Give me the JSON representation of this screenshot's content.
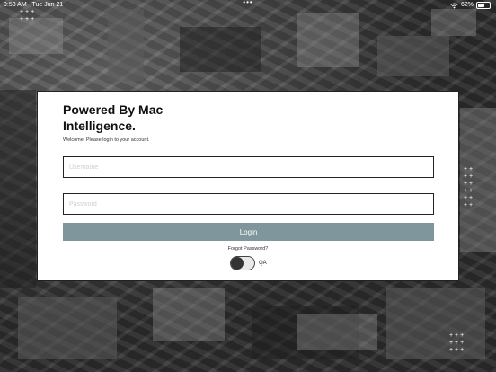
{
  "status_bar": {
    "time": "9:53 AM",
    "date": "Tue Jun 21",
    "multitask": "•••",
    "battery": "62%",
    "battery_level": 0.62
  },
  "card": {
    "title": "Powered By Mac Intelligence.",
    "welcome": "Welcome. Please login to your account.",
    "username_placeholder": "Username",
    "password_placeholder": "Password",
    "login_label": "Login",
    "forgot_label": "Forgot Password?",
    "qa_label": "QA",
    "qa_enabled": false
  },
  "colors": {
    "login_button": "#7f979c"
  }
}
